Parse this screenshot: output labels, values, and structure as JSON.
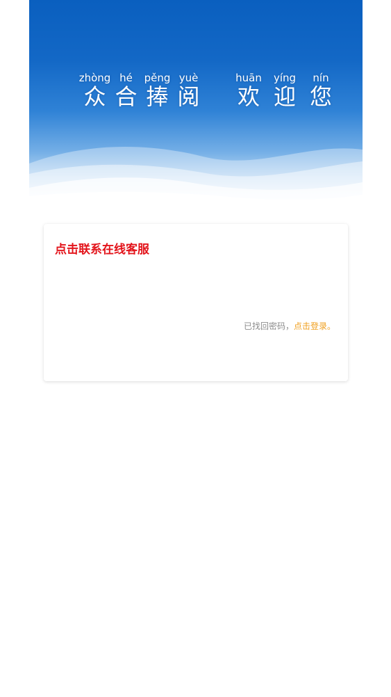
{
  "banner": {
    "left_phrase": [
      {
        "pinyin": "zhòng",
        "hanzi": "众"
      },
      {
        "pinyin": "hé",
        "hanzi": "合"
      },
      {
        "pinyin": "pěng",
        "hanzi": "捧"
      },
      {
        "pinyin": "yuè",
        "hanzi": "阅"
      }
    ],
    "right_phrase": [
      {
        "pinyin": "huān",
        "hanzi": "欢"
      },
      {
        "pinyin": "yíng",
        "hanzi": "迎"
      },
      {
        "pinyin": "nín",
        "hanzi": "您"
      }
    ]
  },
  "card": {
    "contact_link": "点击联系在线客服",
    "recovered_text": "已找回密码，",
    "login_link": "点击登录。"
  },
  "colors": {
    "banner_top": "#0a5fbf",
    "contact_red": "#e3141b",
    "login_orange": "#f0a020",
    "muted_gray": "#8c8c8c"
  }
}
